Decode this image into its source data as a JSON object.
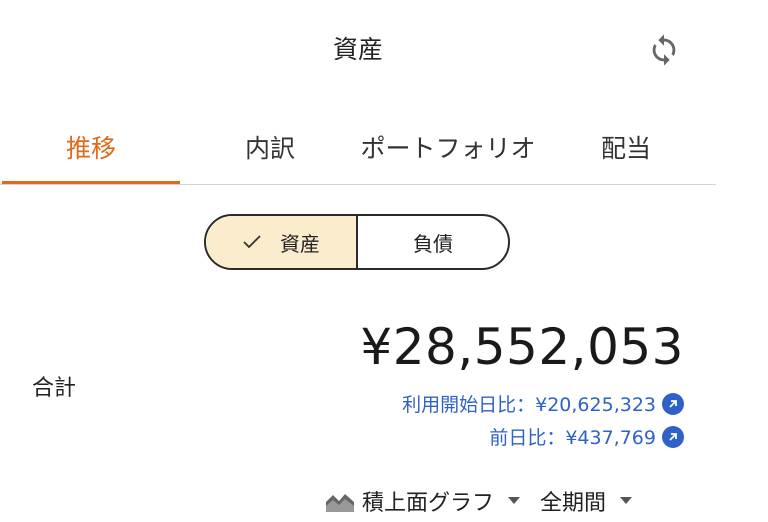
{
  "header": {
    "title": "資産",
    "refresh_icon": "refresh-icon"
  },
  "tabs": [
    {
      "label": "推移",
      "active": true
    },
    {
      "label": "内訳",
      "active": false
    },
    {
      "label": "ポートフォリオ",
      "active": false
    },
    {
      "label": "配当",
      "active": false
    }
  ],
  "segment": {
    "assets_label": "資産",
    "liabilities_label": "負債",
    "selected": "資産"
  },
  "summary": {
    "total_label": "合計",
    "total_amount": "¥28,552,053",
    "since_start": "利用開始日比：¥20,625,323",
    "prev_day": "前日比：¥437,769"
  },
  "chart_controls": {
    "chart_type_label": "積上面グラフ",
    "chart_type_icon": "area-chart-icon",
    "period_label": "全期間"
  },
  "colors": {
    "accent": "#e06a1b",
    "link": "#2f62c8",
    "segment_selected_bg": "#fbeccd"
  }
}
